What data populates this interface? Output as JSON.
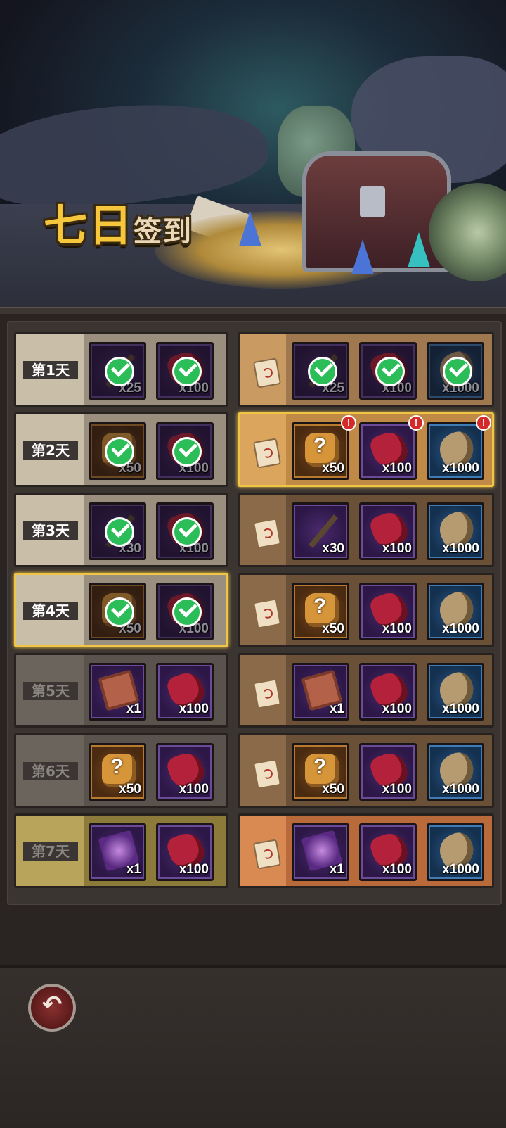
{
  "title": {
    "big": "七日",
    "small": "签到"
  },
  "back_icon_glyph": "↶",
  "days": [
    {
      "label": "第1天",
      "free": [
        {
          "icon": "pickaxe",
          "qty": "x25",
          "claimed": true
        },
        {
          "icon": "ruby",
          "qty": "x100",
          "claimed": true
        }
      ],
      "premium": [
        {
          "icon": "pickaxe",
          "qty": "x25",
          "claimed": true
        },
        {
          "icon": "ruby",
          "qty": "x100",
          "claimed": true
        },
        {
          "icon": "ore",
          "qty": "x1000",
          "claimed": true
        }
      ]
    },
    {
      "label": "第2天",
      "free": [
        {
          "icon": "puzzle",
          "qty": "x50",
          "claimed": true
        },
        {
          "icon": "ruby",
          "qty": "x100",
          "claimed": true
        }
      ],
      "premium": [
        {
          "icon": "puzzle",
          "qty": "x50",
          "alert": true
        },
        {
          "icon": "ruby",
          "qty": "x100",
          "alert": true
        },
        {
          "icon": "ore",
          "qty": "x1000",
          "alert": true
        }
      ]
    },
    {
      "label": "第3天",
      "free": [
        {
          "icon": "pickaxe",
          "qty": "x30",
          "claimed": true
        },
        {
          "icon": "ruby",
          "qty": "x100",
          "claimed": true
        }
      ],
      "premium": [
        {
          "icon": "pickaxe",
          "qty": "x30"
        },
        {
          "icon": "ruby",
          "qty": "x100"
        },
        {
          "icon": "ore",
          "qty": "x1000"
        }
      ]
    },
    {
      "label": "第4天",
      "free": [
        {
          "icon": "puzzle",
          "qty": "x50",
          "claimed": true
        },
        {
          "icon": "ruby",
          "qty": "x100",
          "claimed": true
        }
      ],
      "premium": [
        {
          "icon": "puzzle",
          "qty": "x50"
        },
        {
          "icon": "ruby",
          "qty": "x100"
        },
        {
          "icon": "ore",
          "qty": "x1000"
        }
      ]
    },
    {
      "label": "第5天",
      "free": [
        {
          "icon": "ticket",
          "qty": "x1"
        },
        {
          "icon": "ruby",
          "qty": "x100"
        }
      ],
      "premium": [
        {
          "icon": "ticket",
          "qty": "x1"
        },
        {
          "icon": "ruby",
          "qty": "x100"
        },
        {
          "icon": "ore",
          "qty": "x1000"
        }
      ]
    },
    {
      "label": "第6天",
      "free": [
        {
          "icon": "puzzle",
          "qty": "x50"
        },
        {
          "icon": "ruby",
          "qty": "x100"
        }
      ],
      "premium": [
        {
          "icon": "puzzle",
          "qty": "x50"
        },
        {
          "icon": "ruby",
          "qty": "x100"
        },
        {
          "icon": "ore",
          "qty": "x1000"
        }
      ]
    },
    {
      "label": "第7天",
      "free": [
        {
          "icon": "portal",
          "qty": "x1"
        },
        {
          "icon": "ruby",
          "qty": "x100"
        }
      ],
      "premium": [
        {
          "icon": "portal",
          "qty": "x1"
        },
        {
          "icon": "ruby",
          "qty": "x100"
        },
        {
          "icon": "ore",
          "qty": "x1000"
        }
      ]
    }
  ],
  "colors": {
    "accent_gold": "#f0c445",
    "claimed_green": "#2bbd57",
    "alert_red": "#d42a2a"
  }
}
